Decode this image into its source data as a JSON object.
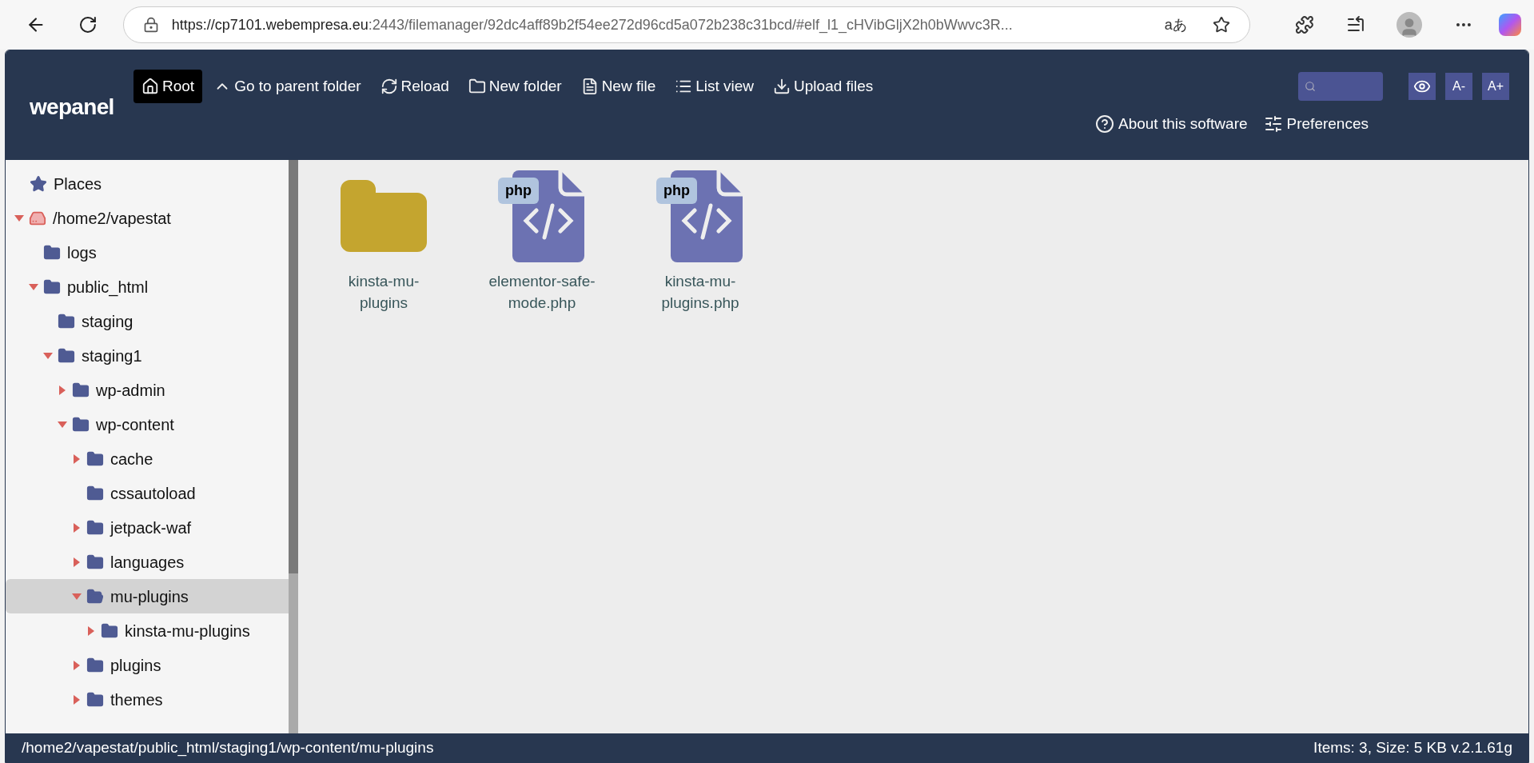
{
  "browser": {
    "url_host": "https://cp7101.webempresa.eu",
    "url_rest": ":2443/filemanager/92dc4aff89b2f54ee272d96cd5a072b238c31bcd/#elf_l1_cHVibGljX2h0bWwvc3R...",
    "translate_glyph": "aあ"
  },
  "toolbar": [
    {
      "kind": "home",
      "label": "Root",
      "selected": true
    },
    {
      "kind": "up",
      "label": "Go to parent folder",
      "selected": false
    },
    {
      "kind": "reload",
      "label": "Reload",
      "selected": false
    },
    {
      "kind": "folder",
      "label": "New folder",
      "selected": false
    },
    {
      "kind": "file",
      "label": "New file",
      "selected": false
    },
    {
      "kind": "list",
      "label": "List view",
      "selected": false
    },
    {
      "kind": "upload",
      "label": "Upload files",
      "selected": false
    }
  ],
  "toolbar_row2": [
    {
      "kind": "help",
      "label": "About this software"
    },
    {
      "kind": "prefs",
      "label": "Preferences"
    }
  ],
  "font_buttons": [
    "A-",
    "A+"
  ],
  "logo": "wepanel",
  "places": "Places",
  "tree": [
    {
      "name": "/home2/vapestat",
      "kind": "volume",
      "expanded": true,
      "selected": false,
      "children": [
        {
          "name": "logs",
          "kind": "folder",
          "selected": false
        },
        {
          "name": "public_html",
          "kind": "folder",
          "expanded": true,
          "selected": false,
          "children": [
            {
              "name": "staging",
              "kind": "folder",
              "selected": false
            },
            {
              "name": "staging1",
              "kind": "folder",
              "expanded": true,
              "selected": false,
              "children": [
                {
                  "name": "wp-admin",
                  "kind": "folder",
                  "expanded": false,
                  "selected": false
                },
                {
                  "name": "wp-content",
                  "kind": "folder",
                  "expanded": true,
                  "selected": false,
                  "children": [
                    {
                      "name": "cache",
                      "kind": "folder",
                      "expanded": false,
                      "selected": false
                    },
                    {
                      "name": "cssautoload",
                      "kind": "folder",
                      "selected": false
                    },
                    {
                      "name": "jetpack-waf",
                      "kind": "folder",
                      "expanded": false,
                      "selected": false
                    },
                    {
                      "name": "languages",
                      "kind": "folder",
                      "expanded": false,
                      "selected": false
                    },
                    {
                      "name": "mu-plugins",
                      "kind": "folder",
                      "expanded": true,
                      "selected": true,
                      "children": [
                        {
                          "name": "kinsta-mu-plugins",
                          "kind": "folder",
                          "expanded": false,
                          "selected": false
                        }
                      ]
                    },
                    {
                      "name": "plugins",
                      "kind": "folder",
                      "expanded": false,
                      "selected": false
                    },
                    {
                      "name": "themes",
                      "kind": "folder",
                      "expanded": false,
                      "selected": false
                    }
                  ]
                }
              ]
            }
          ]
        }
      ]
    }
  ],
  "files": [
    {
      "name_lines": [
        "kinsta-mu-",
        "plugins"
      ],
      "kind": "folder"
    },
    {
      "name_lines": [
        "elementor-safe-",
        "mode.php"
      ],
      "kind": "php",
      "badge": "php"
    },
    {
      "name_lines": [
        "kinsta-mu-",
        "plugins.php"
      ],
      "kind": "php",
      "badge": "php"
    }
  ],
  "status_bar": {
    "path": "/home2/vapestat/public_html/staging1/wp-content/mu-plugins",
    "info": "Items: 3, Size: 5 KB v.2.1.61g"
  }
}
